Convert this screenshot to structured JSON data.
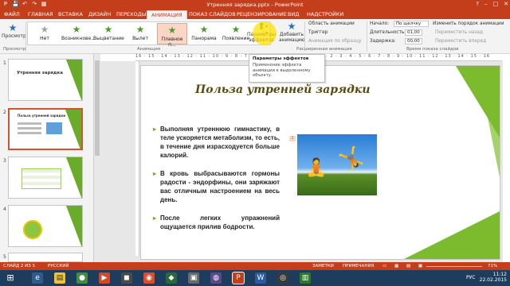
{
  "window": {
    "title": "Утренняя зарядка.pptx - PowerPoint",
    "controls": [
      "?",
      "–",
      "□",
      "✕"
    ]
  },
  "qat": [
    "P",
    "💾",
    "↶",
    "↷",
    "▦"
  ],
  "tabs": {
    "file": "ФАЙЛ",
    "items": [
      "ГЛАВНАЯ",
      "ВСТАВКА",
      "ДИЗАЙН",
      "ПЕРЕХОДЫ",
      "АНИМАЦИЯ",
      "ПОКАЗ СЛАЙДОВ",
      "РЕЦЕНЗИРОВАНИЕ",
      "ВИД",
      "НАДСТРОЙКИ"
    ],
    "active": "АНИМАЦИЯ"
  },
  "ribbon": {
    "preview": {
      "label": "Просмотр",
      "group": "Просмотр"
    },
    "animations": [
      {
        "label": "Нет"
      },
      {
        "label": "Возникнове..."
      },
      {
        "label": "Выцветание"
      },
      {
        "label": "Вылет"
      },
      {
        "label": "Плавное п..."
      },
      {
        "label": "Панорама"
      },
      {
        "label": "Появление"
      }
    ],
    "animations_group": "Анимация",
    "effect_params": "Параметры эффектов",
    "add_animation": "Добавить анимацию",
    "advanced_group": "Расширенная анимация",
    "anim_area": "Область анимации",
    "trigger": "Триггер",
    "anim_painter": "Анимация по образцу",
    "start_label": "Начало:",
    "start_value": "По щелчку",
    "duration_label": "Длительность:",
    "duration_value": "01,00",
    "delay_label": "Задержка:",
    "delay_value": "00,00",
    "timing_group": "Время показа слайдов",
    "reorder": "Изменить порядок анимации",
    "move_back": "Переместить назад",
    "move_forward": "Переместить вперед"
  },
  "ruler_text": "16 · 15 · 14 · 13 · 12 · 11 · 10 · 9 · 8 · 7 · 6 · 5 · 4 · 3 · 2 · 1 · 0 · 1 · 2 · 3 · 4 · 5 · 6 · 7 · 8 · 9 · 10 · 11 · 12 · 13 · 14 · 15 · 16",
  "tooltip": {
    "title": "Параметры эффектов",
    "desc": "Применение эффекта анимации к выделенному объекту."
  },
  "thumbnails": [
    {
      "num": "1",
      "title": "Утренняя зарядка"
    },
    {
      "num": "2",
      "title": "Польза утренней зарядки"
    },
    {
      "num": "3",
      "title": ""
    },
    {
      "num": "4",
      "title": ""
    },
    {
      "num": "5",
      "title": ""
    }
  ],
  "slide": {
    "title": "Польза утренней зарядки",
    "bullets": [
      "Выполняя утреннюю гимнастику, в теле ускоряется метаболизм, то есть, в течение дня израсходуется больше калорий.",
      "В кровь выбрасываются гормоны радости - эндорфины, они заряжают вас отличным настроением на весь день.",
      "После легких упражнений ощущается прилив бодрости."
    ],
    "anim_tag": "1"
  },
  "statusbar": {
    "slide": "СЛАЙД 2 ИЗ 5",
    "lang": "РУССКИЙ",
    "notes": "ЗАМЕТКИ",
    "comments": "ПРИМЕЧАНИЯ",
    "zoom": "71%"
  },
  "taskbar": {
    "time": "11:12",
    "date": "22.02.2015",
    "lang": "РУС"
  },
  "colors": {
    "accent": "#c43e1c",
    "green": "#7dbb2e",
    "title": "#5a4a12"
  }
}
